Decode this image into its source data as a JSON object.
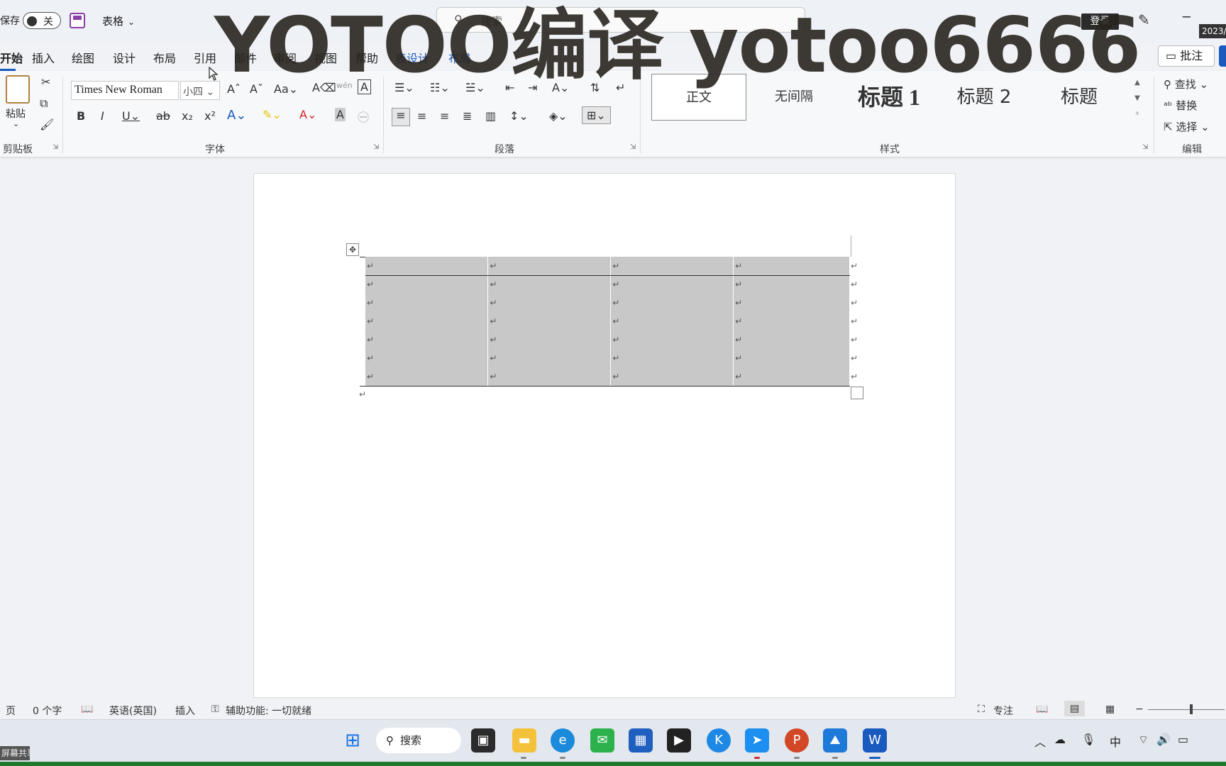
{
  "titlebar": {
    "autosave_label": "保存",
    "autosave_state": "关",
    "doc_name": "表格",
    "search_placeholder": "搜索",
    "login_label": "登录"
  },
  "tabs": [
    {
      "label": "开始",
      "active": true
    },
    {
      "label": "插入"
    },
    {
      "label": "绘图"
    },
    {
      "label": "设计"
    },
    {
      "label": "布局"
    },
    {
      "label": "引用"
    },
    {
      "label": "邮件"
    },
    {
      "label": "审阅"
    },
    {
      "label": "视图"
    },
    {
      "label": "帮助"
    },
    {
      "label": "表设计",
      "context": true
    },
    {
      "label": "布局",
      "context": true
    }
  ],
  "comment_button": "批注",
  "ribbon": {
    "clipboard": {
      "paste_label": "粘贴",
      "group_label": "剪贴板"
    },
    "font": {
      "font_name": "Times New Roman",
      "font_size": "小四",
      "group_label": "字体"
    },
    "paragraph": {
      "group_label": "段落"
    },
    "styles": {
      "group_label": "样式",
      "items": [
        "正文",
        "无间隔",
        "标题 1",
        "标题 2",
        "标题"
      ]
    },
    "editing": {
      "group_label": "编辑",
      "find": "查找",
      "replace": "替换",
      "select": "选择"
    }
  },
  "document": {
    "table": {
      "rows": 7,
      "cols": 4,
      "cell_mark": "↵",
      "shading_color": "#c8c8c8"
    },
    "paragraph_mark": "↵"
  },
  "statusbar": {
    "page": "页",
    "word_count": "0 个字",
    "language": "英语(英国)",
    "mode": "插入",
    "accessibility": "辅助功能: 一切就绪",
    "focus": "专注"
  },
  "taskbar": {
    "search_label": "搜索",
    "ime": "中",
    "clock": "2023/"
  },
  "screen_share_tag": "屏幕共享",
  "watermark": "YOTOO编译  yotoo6666",
  "colors": {
    "accent": "#185abd",
    "save_icon": "#8b3fa8",
    "table_shading": "#c8c8c8"
  }
}
